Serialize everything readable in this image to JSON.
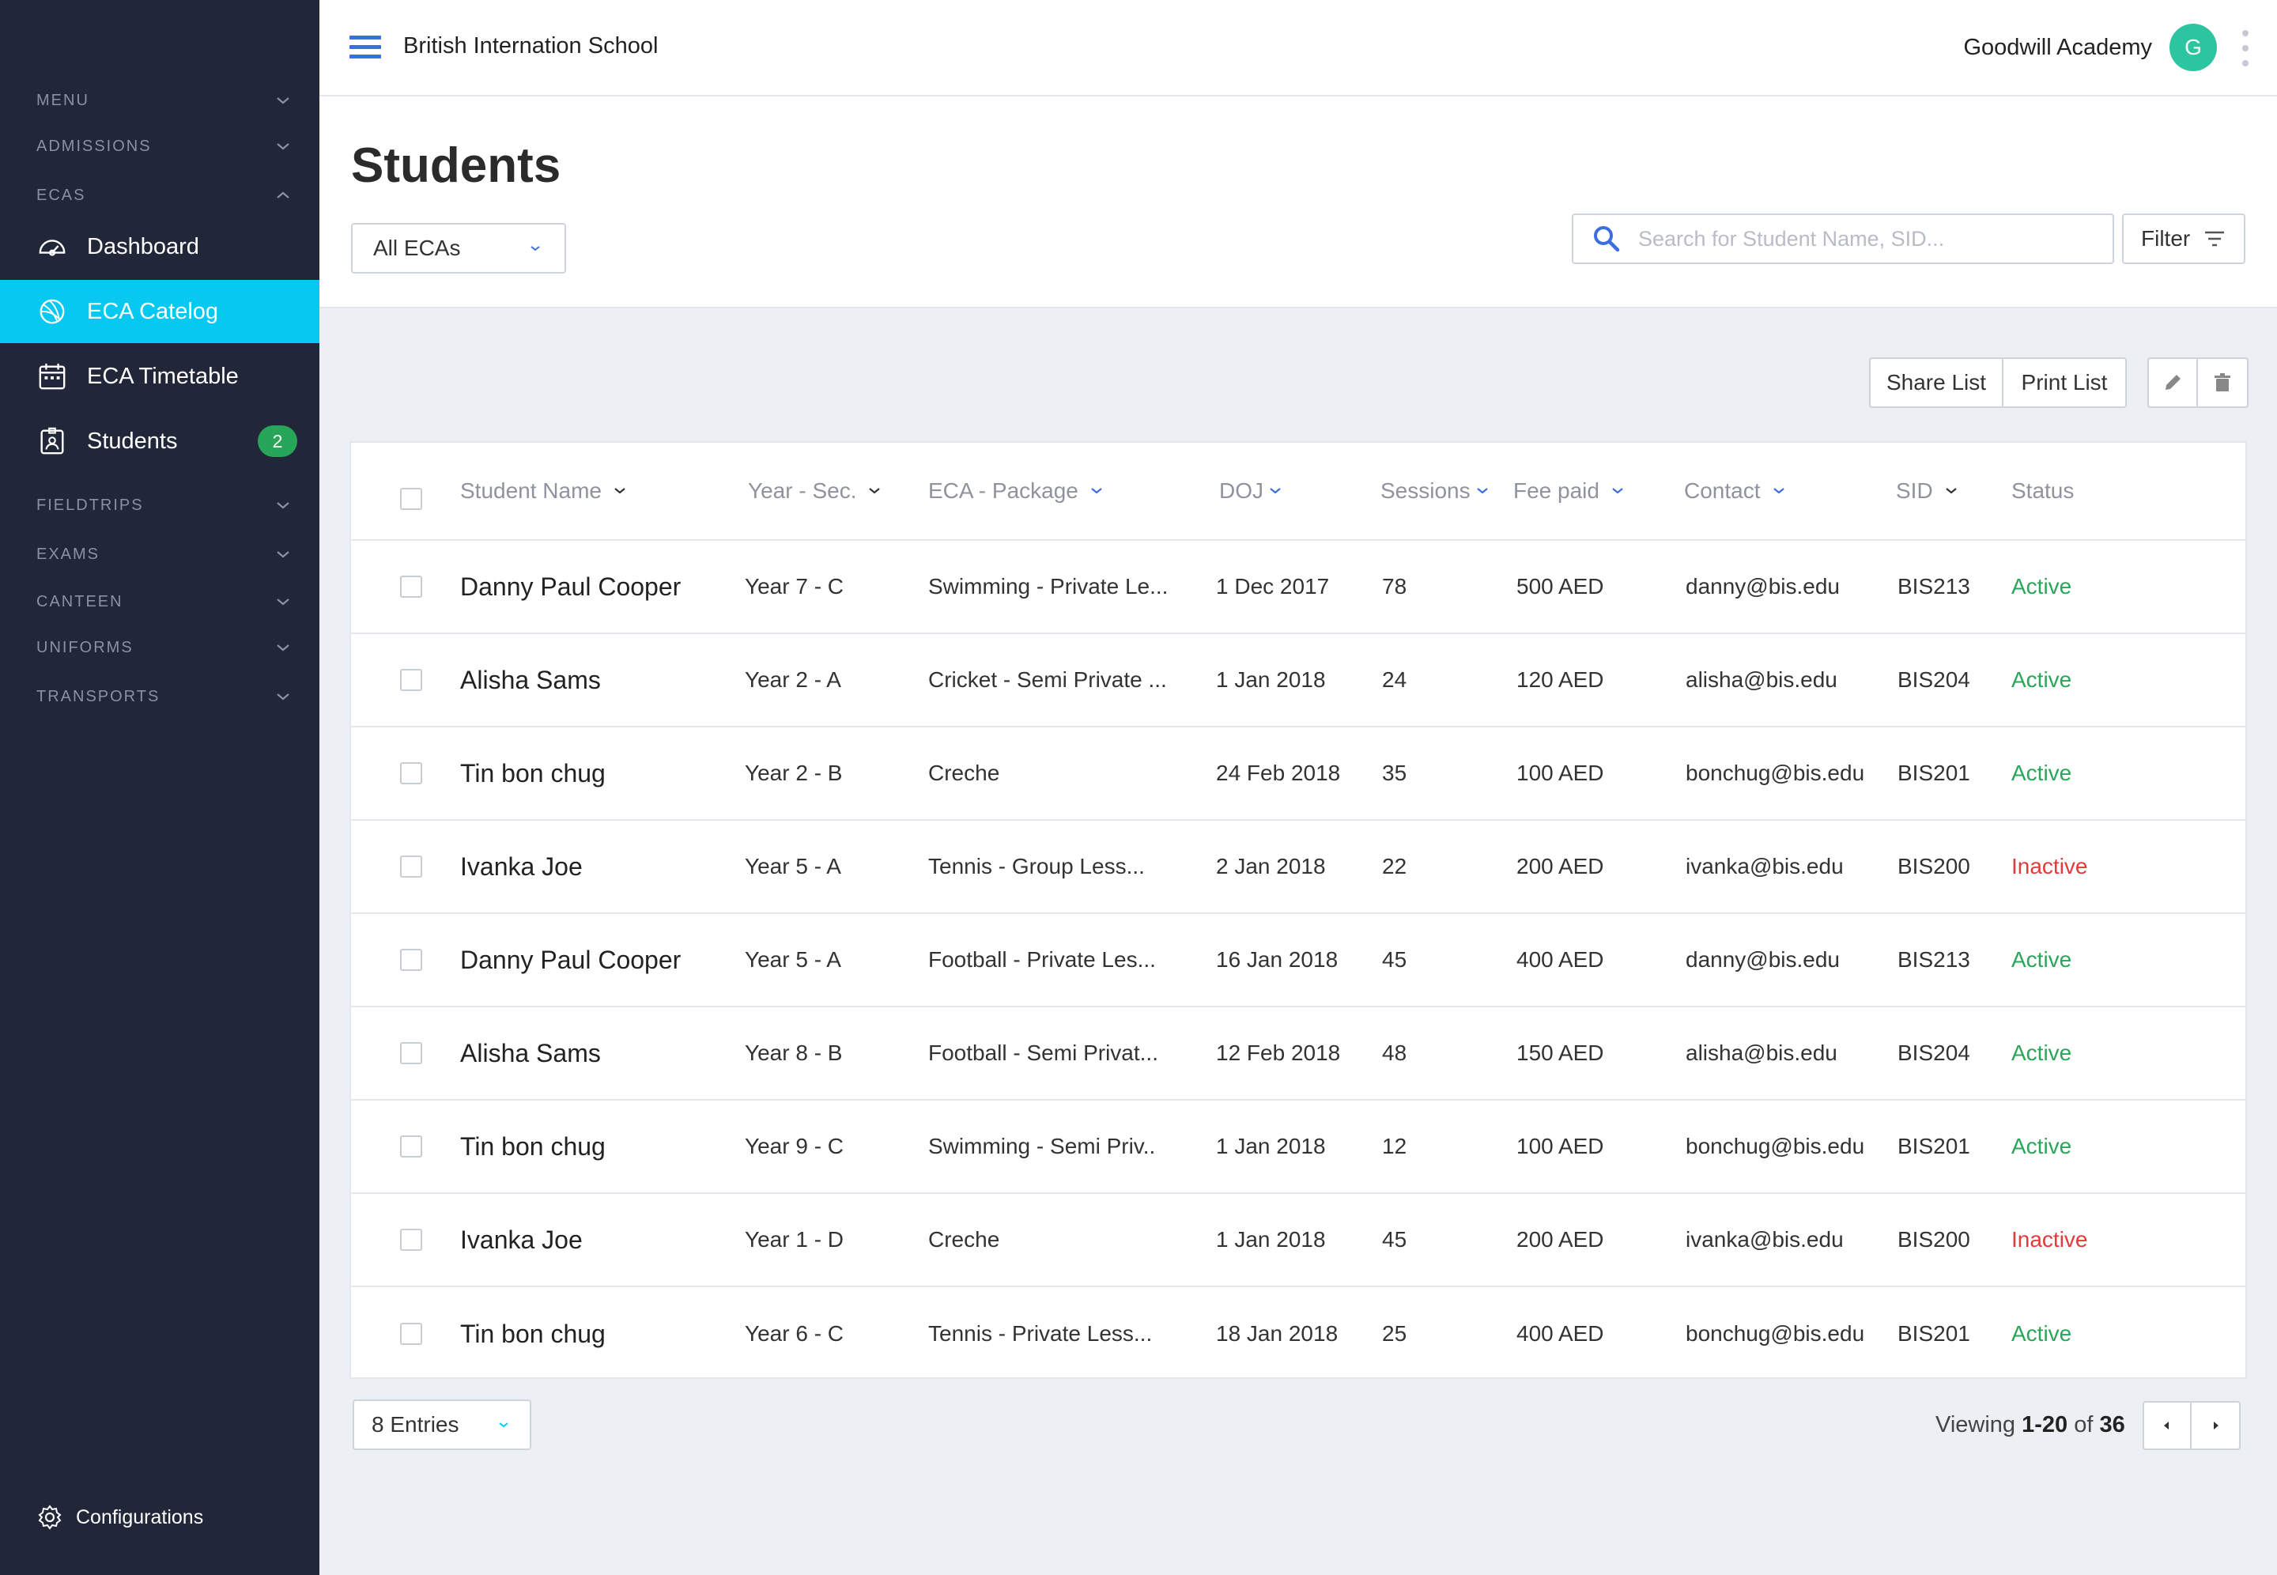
{
  "sidebar": {
    "sections": [
      {
        "label": "MENU",
        "expanded": false
      },
      {
        "label": "ADMISSIONS",
        "expanded": false
      },
      {
        "label": "ECAS",
        "expanded": true
      }
    ],
    "items": [
      {
        "label": "Dashboard",
        "icon": "dashboard-icon"
      },
      {
        "label": "ECA Catelog",
        "icon": "catalog-icon",
        "active": true
      },
      {
        "label": "ECA Timetable",
        "icon": "calendar-icon"
      },
      {
        "label": "Students",
        "icon": "student-icon",
        "badge": "2"
      }
    ],
    "sections2": [
      {
        "label": "FIELDTRIPS"
      },
      {
        "label": "EXAMS"
      },
      {
        "label": "CANTEEN"
      },
      {
        "label": "UNIFORMS"
      },
      {
        "label": "TRANSPORTS"
      }
    ],
    "config_label": "Configurations"
  },
  "topbar": {
    "school": "British Internation School",
    "academy": "Goodwill Academy",
    "avatar_letter": "G",
    "avatar_color": "#2dc4a0"
  },
  "page": {
    "title": "Students",
    "eca_filter": "All ECAs",
    "search_placeholder": "Search for Student Name, SID...",
    "filter_label": "Filter",
    "share_label": "Share List",
    "print_label": "Print List"
  },
  "table": {
    "headers": [
      "Student Name",
      "Year - Sec.",
      "ECA - Package",
      "DOJ",
      "Sessions",
      "Fee paid",
      "Contact",
      "SID",
      "Status"
    ],
    "rows": [
      {
        "name": "Danny Paul Cooper",
        "year": "Year 7 - C",
        "eca": "Swimming - Private Le...",
        "doj": "1 Dec 2017",
        "sessions": "78",
        "fee": "500 AED",
        "contact": "danny@bis.edu",
        "sid": "BIS213",
        "status": "Active"
      },
      {
        "name": "Alisha Sams",
        "year": "Year 2 - A",
        "eca": "Cricket - Semi Private ...",
        "doj": "1 Jan 2018",
        "sessions": "24",
        "fee": "120 AED",
        "contact": "alisha@bis.edu",
        "sid": "BIS204",
        "status": "Active"
      },
      {
        "name": "Tin bon chug",
        "year": "Year 2 - B",
        "eca": "Creche",
        "doj": "24 Feb 2018",
        "sessions": "35",
        "fee": "100 AED",
        "contact": "bonchug@bis.edu",
        "sid": "BIS201",
        "status": "Active"
      },
      {
        "name": "Ivanka Joe",
        "year": "Year 5 - A",
        "eca": "Tennis - Group Less...",
        "doj": "2 Jan 2018",
        "sessions": "22",
        "fee": "200 AED",
        "contact": "ivanka@bis.edu",
        "sid": "BIS200",
        "status": "Inactive"
      },
      {
        "name": "Danny Paul Cooper",
        "year": "Year 5 - A",
        "eca": "Football - Private Les...",
        "doj": "16 Jan 2018",
        "sessions": "45",
        "fee": "400 AED",
        "contact": "danny@bis.edu",
        "sid": "BIS213",
        "status": "Active"
      },
      {
        "name": "Alisha Sams",
        "year": "Year 8 - B",
        "eca": "Football - Semi Privat...",
        "doj": "12 Feb 2018",
        "sessions": "48",
        "fee": "150 AED",
        "contact": "alisha@bis.edu",
        "sid": "BIS204",
        "status": "Active"
      },
      {
        "name": "Tin bon chug",
        "year": "Year 9 - C",
        "eca": "Swimming - Semi Priv..",
        "doj": "1 Jan 2018",
        "sessions": "12",
        "fee": "100 AED",
        "contact": "bonchug@bis.edu",
        "sid": "BIS201",
        "status": "Active"
      },
      {
        "name": "Ivanka Joe",
        "year": "Year 1 - D",
        "eca": "Creche",
        "doj": "1 Jan 2018",
        "sessions": "45",
        "fee": "200 AED",
        "contact": "ivanka@bis.edu",
        "sid": "BIS200",
        "status": "Inactive"
      },
      {
        "name": "Tin bon chug",
        "year": "Year 6 - C",
        "eca": "Tennis - Private Less...",
        "doj": "18 Jan 2018",
        "sessions": "25",
        "fee": "400 AED",
        "contact": "bonchug@bis.edu",
        "sid": "BIS201",
        "status": "Active"
      }
    ]
  },
  "footer": {
    "entries": "8 Entries",
    "viewing_prefix": "Viewing",
    "viewing_range": "1-20",
    "viewing_of": "of",
    "viewing_total": "36"
  },
  "colors": {
    "sidebar_bg": "#222639",
    "accent": "#06c8f0",
    "active_status": "#2aa65a",
    "inactive_status": "#e33b3b"
  }
}
